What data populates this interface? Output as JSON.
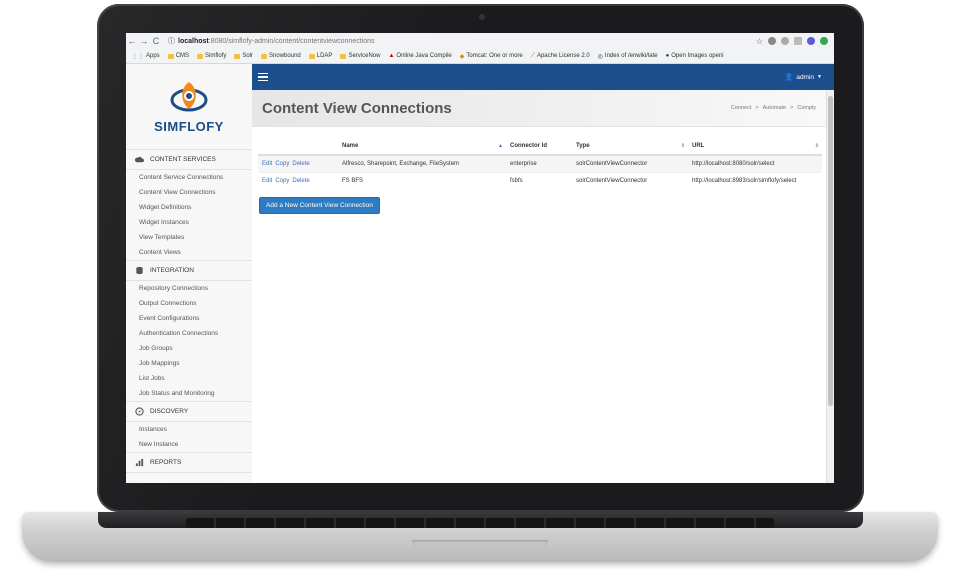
{
  "browser": {
    "url_host": "localhost",
    "url_path": ":8080/simflofy-admin/content/contentviewconnections",
    "bookmarks": [
      "Apps",
      "CMS",
      "Simflofy",
      "Solr",
      "Snowbound",
      "LDAP",
      "ServiceNow",
      "Online Java Compile",
      "Tomcat: One or more",
      "Apache License 2.0",
      "Index of /enwiki/late",
      "Open Images openi"
    ]
  },
  "sidebar": {
    "logo_text": "SIMFLOFY",
    "sections": [
      {
        "title": "CONTENT SERVICES",
        "items": [
          "Content Service Connections",
          "Content View Connections",
          "Widget Definitions",
          "Widget Instances",
          "View Templates",
          "Content Views"
        ]
      },
      {
        "title": "INTEGRATION",
        "items": [
          "Repository Connections",
          "Output Connections",
          "Event Configurations",
          "Authentication Connections",
          "Job Groups",
          "Job Mappings",
          "List Jobs",
          "Job Status and Monitoring"
        ]
      },
      {
        "title": "DISCOVERY",
        "items": [
          "Instances",
          "New Instance"
        ]
      },
      {
        "title": "REPORTS",
        "items": []
      }
    ]
  },
  "topbar": {
    "user": "admin"
  },
  "page": {
    "title": "Content View Connections",
    "breadcrumbs": [
      "Connect",
      ">",
      "Automate",
      ">",
      "Comply"
    ]
  },
  "table": {
    "headers": [
      "",
      "Name",
      "Connector Id",
      "Type",
      "URL"
    ],
    "rows": [
      {
        "actions": [
          "Edit",
          "Copy",
          "Delete"
        ],
        "name": "Alfresco, Sharepoint, Exchange, FileSystem",
        "connector_id": "enterprise",
        "type": "solrContentViewConnector",
        "url": "http://localhost:8080/solr/select"
      },
      {
        "actions": [
          "Edit",
          "Copy",
          "Delete"
        ],
        "name": "FS BFS",
        "connector_id": "fsbfs",
        "type": "solrContentViewConnector",
        "url": "http://localhost:8983/solr/simflofy/select"
      }
    ]
  },
  "add_button": "Add a New Content View Connection",
  "colors": {
    "topbar": "#1d4f8f",
    "button": "#2f7bc1",
    "link": "#3a72b6",
    "logo_orange": "#f08a1c",
    "logo_blue": "#1d4d86"
  }
}
